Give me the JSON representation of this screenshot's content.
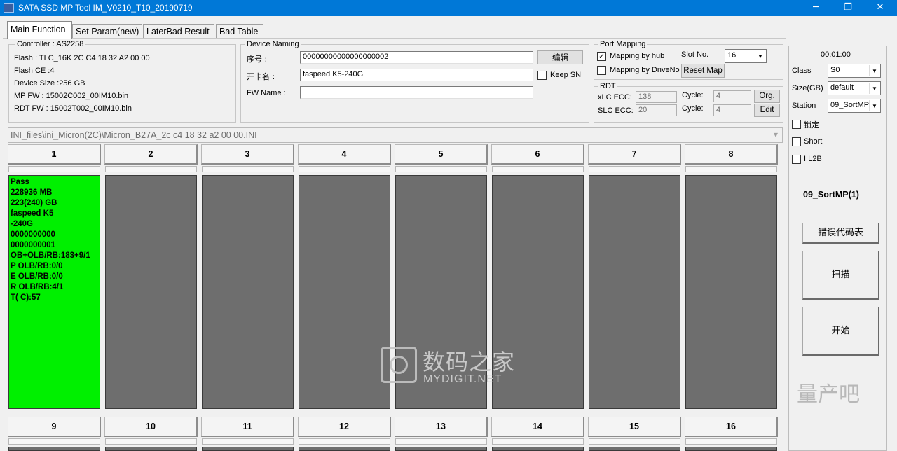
{
  "window": {
    "title": "SATA SSD MP Tool IM_V0210_T10_20190719",
    "controls": {
      "minimize": "─",
      "maximize": "❐",
      "close": "✕"
    }
  },
  "tabs": [
    {
      "label": "Main Function",
      "active": true
    },
    {
      "label": "Set Param(new)",
      "active": false
    },
    {
      "label": "LaterBad Result",
      "active": false
    },
    {
      "label": "Bad Table",
      "active": false
    }
  ],
  "controller": {
    "title": "Controller : AS2258",
    "lines": [
      "Flash : TLC_16K 2C C4 18 32 A2 00 00",
      "Flash CE :4",
      "Device Size :256 GB",
      "MP FW :   15002C002_00IM10.bin",
      "RDT FW : 15002T002_00IM10.bin"
    ]
  },
  "device_naming": {
    "title": "Device Naming",
    "serial_label": "序号 :",
    "serial_value": "00000000000000000002",
    "name_label": "开卡名 :",
    "name_value": "faspeed K5-240G",
    "fw_label": "FW Name :",
    "fw_value": "",
    "edit_button": "编辑",
    "keep_sn_label": "Keep SN",
    "keep_sn_checked": false
  },
  "port_mapping": {
    "title": "Port Mapping",
    "by_hub_label": "Mapping by hub",
    "by_hub_checked": true,
    "by_drive_label": "Mapping by DriveNo",
    "by_drive_checked": false,
    "slot_label": "Slot No.",
    "slot_value": "16",
    "reset_button": "Reset Map"
  },
  "rdt": {
    "title": "RDT",
    "xlc_label": "xLC ECC:",
    "xlc_value": "138",
    "slc_label": "SLC ECC:",
    "slc_value": "20",
    "cycle_label": "Cycle:",
    "cycle1_value": "4",
    "cycle2_value": "4",
    "org_button": "Org.",
    "edit_button": "Edit"
  },
  "ini_path": "INI_files\\ini_Micron(2C)\\Micron_B27A_2c c4 18 32 a2 00 00.INI",
  "ports_top": [
    "1",
    "2",
    "3",
    "4",
    "5",
    "6",
    "7",
    "8"
  ],
  "ports_bottom": [
    "9",
    "10",
    "11",
    "12",
    "13",
    "14",
    "15",
    "16"
  ],
  "port1_status": [
    "Pass",
    "228936 MB",
    "223(240) GB",
    "faspeed K5",
    "-240G",
    "0000000000",
    "0000000001",
    "OB+OLB/RB:183+9/1",
    "P OLB/RB:0/0",
    "E OLB/RB:0/0",
    "R OLB/RB:4/1",
    "T(    C):57"
  ],
  "right_panel": {
    "timer": "00:01:00",
    "class_label": "Class",
    "class_value": "S0",
    "size_label": "Size(GB)",
    "size_value": "default",
    "station_label": "Station",
    "station_value": "09_SortMP",
    "lock_label": "锁定",
    "short_label": "Short",
    "l2b_label": "I L2B",
    "station_name": "09_SortMP(1)",
    "error_code_button": "错误代码表",
    "scan_button": "扫描",
    "start_button": "开始",
    "watermark": "量产吧"
  },
  "watermark": {
    "cn": "数码之家",
    "en": "MYDIGIT.NET"
  },
  "colors": {
    "titlebar": "#0078d7",
    "pass": "#00f000",
    "slot_idle": "#6e6e6e"
  }
}
